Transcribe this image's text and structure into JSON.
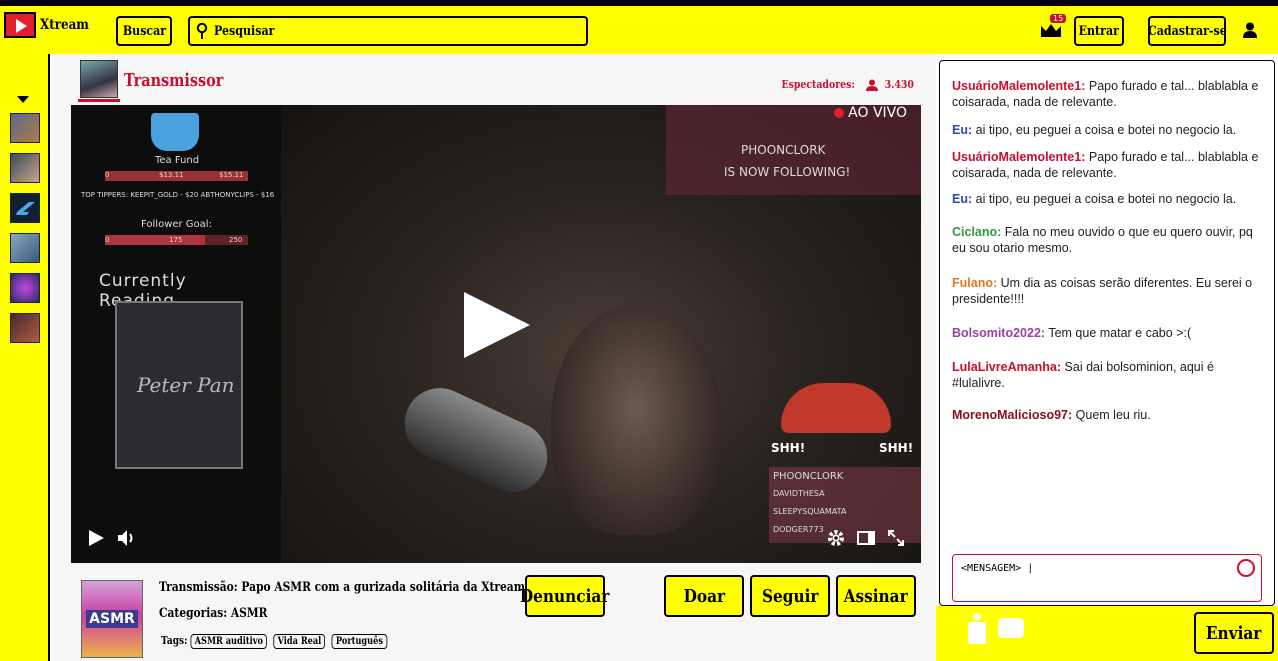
{
  "header": {
    "logo_text": "Xtream",
    "buscar_label": "Buscar",
    "search_placeholder": "Pesquisar",
    "notifications_count": "15",
    "login_label": "Entrar",
    "register_label": "Cadastrar-se"
  },
  "stream": {
    "streamer_name": "Transmissor",
    "viewers_label": "Espectadores:",
    "viewers_count": "3.430",
    "live_label": "AO VIVO",
    "title_line": "Transmissão:  Papo ASMR com a gurizada solitária da Xtream",
    "category_line": "Categorias:  ASMR",
    "thumb_label": "ASMR",
    "tags_label": "Tags:",
    "tags": [
      "ASMR auditivo",
      "Vida Real",
      "Português"
    ]
  },
  "video_overlay": {
    "tea_fund": "Tea Fund",
    "tea_values": [
      "0",
      "$13.11",
      "$15.11"
    ],
    "top_tippers": "TOP TIPPERS:   KEEPIT_GOLD - $20   ABTHONYCLIPS - $16",
    "follower_goal": "Follower Goal:",
    "follower_values": [
      "0",
      "175",
      "250"
    ],
    "currently_reading": "Currently Reading....",
    "book_title": "Peter Pan",
    "follow_name": "PHOONCLORK",
    "follow_text": "IS NOW FOLLOWING!",
    "shh": "SHH!",
    "follower_list": [
      "PHOONCLORK",
      "DAVIDTHESA",
      "SLEEPYSQUAMATA",
      "DODGER773"
    ]
  },
  "actions": {
    "report_label": "Denunciar",
    "donate_label": "Doar",
    "follow_label": "Seguir",
    "subscribe_label": "Assinar",
    "send_label": "Enviar"
  },
  "chat": {
    "messages": [
      {
        "user": "UsuárioMalemolente1:",
        "text": "Papo furado e tal... blablabla e coisarada, nada de relevante.",
        "color": "#c8102e"
      },
      {
        "user": "Eu:",
        "text": "ai tipo, eu peguei a coisa e botei no negocio la.",
        "color": "#2a4bb5"
      },
      {
        "user": "UsuárioMalemolente1:",
        "text": "Papo furado e tal... blablabla e coisarada, nada de relevante.",
        "color": "#c8102e"
      },
      {
        "user": "Eu:",
        "text": "ai tipo, eu peguei a coisa e botei no negocio la.",
        "color": "#2a4bb5"
      },
      {
        "user": "Ciclano:",
        "text": "Fala no meu ouvido o que eu quero ouvir, pq eu sou otario mesmo.",
        "color": "#2e9a3e"
      },
      {
        "user": "Fulano:",
        "text": "Um dia as coisas serão diferentes. Eu serei o presidente!!!!",
        "color": "#e07a1f"
      },
      {
        "user": "Bolsomito2022:",
        "text": "Tem que matar e cabo >:(",
        "color": "#9b3fa8"
      },
      {
        "user": "LulaLivreAmanha:",
        "text": "Sai dai bolsominion, aqui é #lulalivre.",
        "color": "#c8102e"
      },
      {
        "user": "MorenoMalicioso97:",
        "text": "Quem leu riu.",
        "color": "#8a1020"
      }
    ],
    "input_placeholder": "<MENSAGEM>  |"
  }
}
